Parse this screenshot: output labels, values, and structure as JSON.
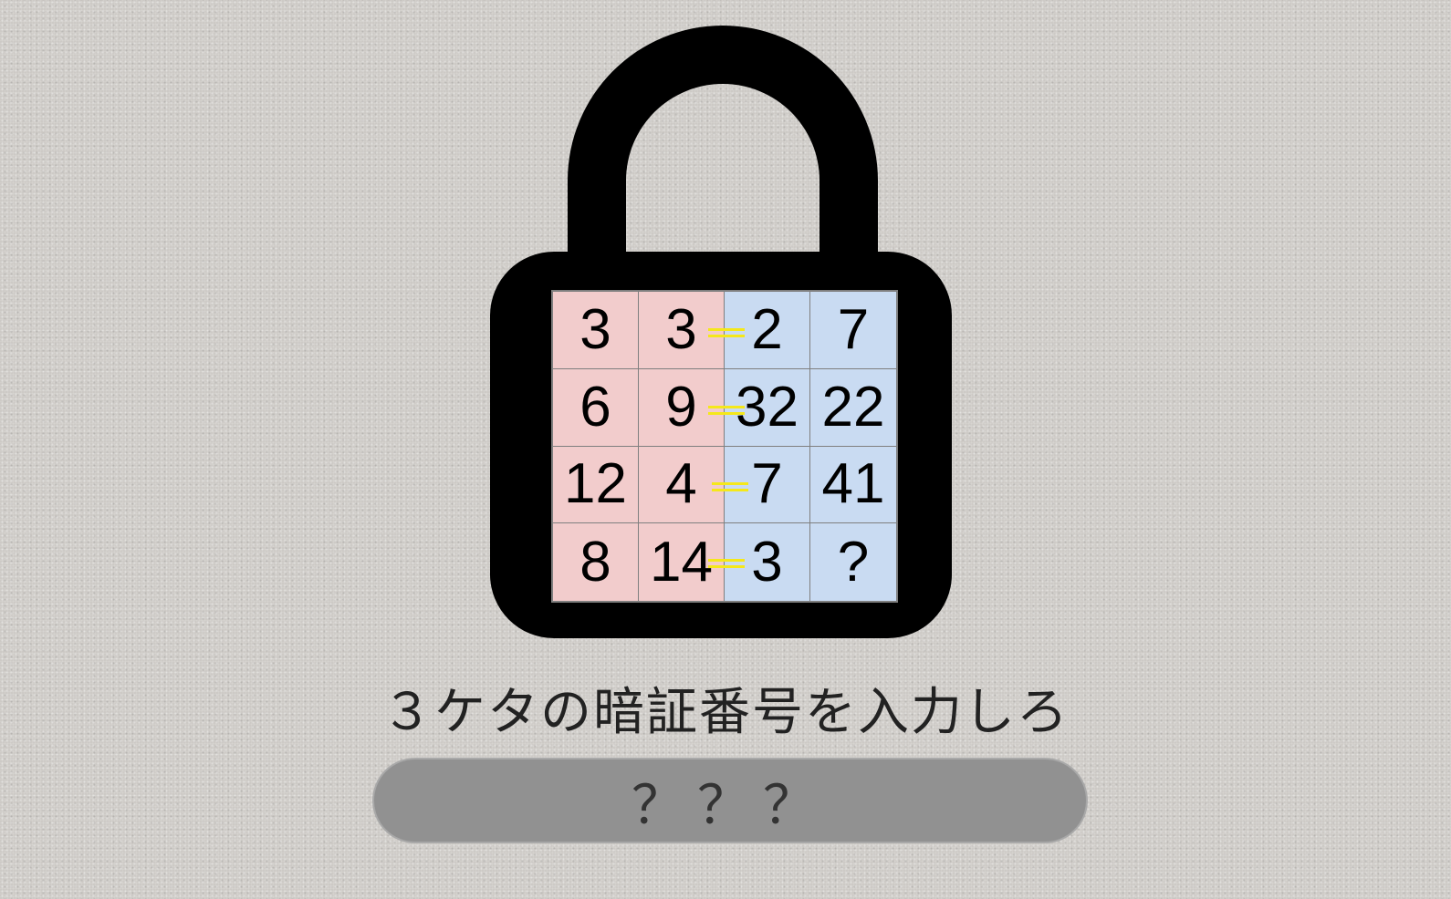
{
  "puzzle": {
    "cells": [
      [
        "3",
        "3",
        "2",
        "7"
      ],
      [
        "6",
        "9",
        "32",
        "22"
      ],
      [
        "12",
        "4",
        "7",
        "41"
      ],
      [
        "8",
        "14",
        "3",
        "?"
      ]
    ],
    "left_color": "#f2cccc",
    "right_color": "#c9dbf2",
    "equals_color": "#f5e81a",
    "lock_color": "#000000"
  },
  "prompt": {
    "text": "３ケタの暗証番号を入力しろ"
  },
  "answer": {
    "value": "？？？"
  }
}
